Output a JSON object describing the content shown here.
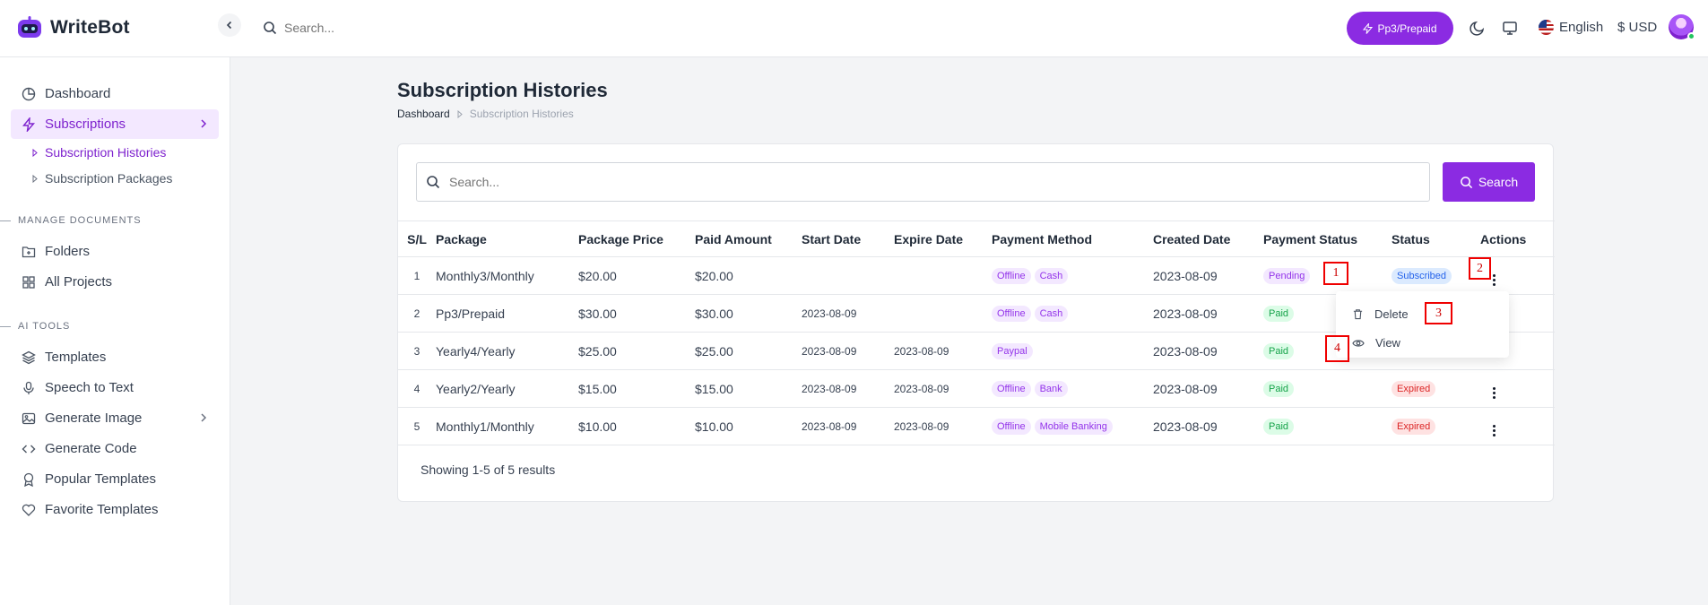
{
  "app": {
    "name": "WriteBot"
  },
  "header": {
    "search_placeholder": "Search...",
    "plan_button": "Pp3/Prepaid",
    "language": "English",
    "currency": "$ USD"
  },
  "sidebar": {
    "dashboard": "Dashboard",
    "subscriptions": "Subscriptions",
    "sub_histories": "Subscription Histories",
    "sub_packages": "Subscription Packages",
    "section_docs": "MANAGE DOCUMENTS",
    "folders": "Folders",
    "all_projects": "All Projects",
    "section_ai": "AI TOOLS",
    "templates": "Templates",
    "speech_to_text": "Speech to Text",
    "generate_image": "Generate Image",
    "generate_code": "Generate Code",
    "popular_templates": "Popular Templates",
    "favorite_templates": "Favorite Templates"
  },
  "page": {
    "title": "Subscription Histories",
    "breadcrumb": [
      "Dashboard",
      "Subscription Histories"
    ],
    "search_placeholder": "Search...",
    "search_button": "Search",
    "footer": "Showing 1-5 of 5 results"
  },
  "table": {
    "headers": [
      "S/L",
      "Package",
      "Package Price",
      "Paid Amount",
      "Start Date",
      "Expire Date",
      "Payment Method",
      "Created Date",
      "Payment Status",
      "Status",
      "Actions"
    ],
    "rows": [
      {
        "sl": "1",
        "package": "Monthly3/Monthly",
        "price": "$20.00",
        "paid": "$20.00",
        "start": "",
        "expire": "",
        "methods": [
          "Offline",
          "Cash"
        ],
        "created": "2023-08-09",
        "payment_status": "Pending",
        "status": "Subscribed"
      },
      {
        "sl": "2",
        "package": "Pp3/Prepaid",
        "price": "$30.00",
        "paid": "$30.00",
        "start": "2023-08-09",
        "expire": "",
        "methods": [
          "Offline",
          "Cash"
        ],
        "created": "2023-08-09",
        "payment_status": "Paid",
        "status": ""
      },
      {
        "sl": "3",
        "package": "Yearly4/Yearly",
        "price": "$25.00",
        "paid": "$25.00",
        "start": "2023-08-09",
        "expire": "2023-08-09",
        "methods": [
          "Paypal"
        ],
        "created": "2023-08-09",
        "payment_status": "Paid",
        "status": ""
      },
      {
        "sl": "4",
        "package": "Yearly2/Yearly",
        "price": "$15.00",
        "paid": "$15.00",
        "start": "2023-08-09",
        "expire": "2023-08-09",
        "methods": [
          "Offline",
          "Bank"
        ],
        "created": "2023-08-09",
        "payment_status": "Paid",
        "status": "Expired"
      },
      {
        "sl": "5",
        "package": "Monthly1/Monthly",
        "price": "$10.00",
        "paid": "$10.00",
        "start": "2023-08-09",
        "expire": "2023-08-09",
        "methods": [
          "Offline",
          "Mobile Banking"
        ],
        "created": "2023-08-09",
        "payment_status": "Paid",
        "status": "Expired"
      }
    ]
  },
  "dropdown": {
    "delete": "Delete",
    "view": "View"
  },
  "marks": [
    "1",
    "2",
    "3",
    "4"
  ],
  "colors": {
    "accent": "#8b2be2",
    "accent_light": "#f3e8ff"
  }
}
